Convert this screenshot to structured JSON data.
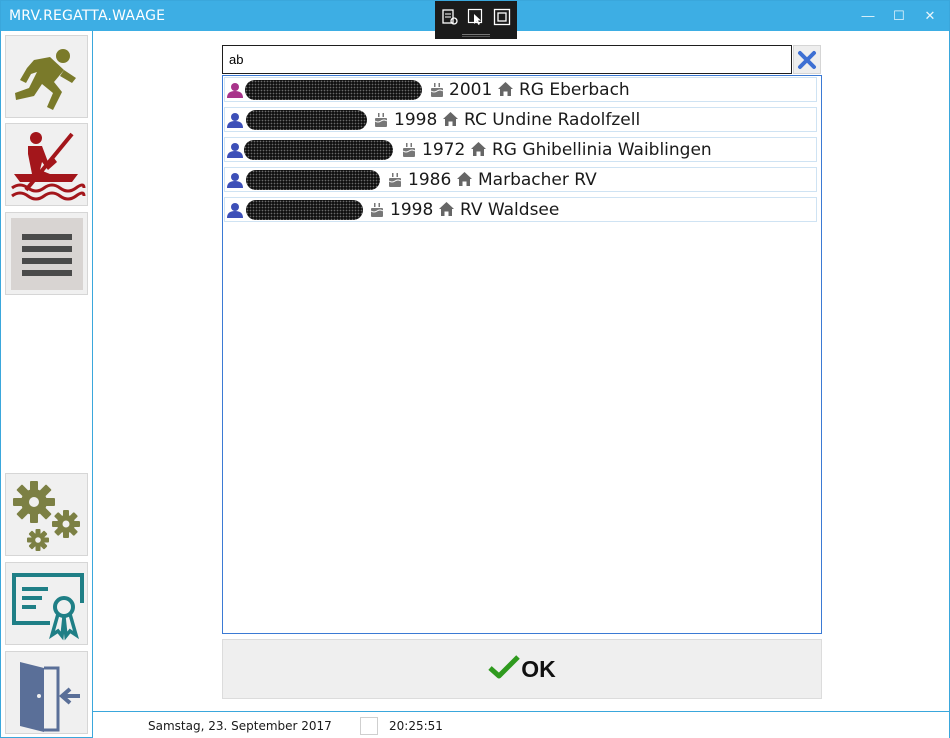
{
  "window": {
    "title": "MRV.REGATTA.WAAGE",
    "minimize_glyph": "—",
    "maximize_glyph": "☐",
    "close_glyph": "✕"
  },
  "sidebar": {
    "items": [
      {
        "name": "athlete",
        "icon": "runner-icon",
        "color": "#7a7a2a"
      },
      {
        "name": "boat",
        "icon": "rowing-boat-icon",
        "color": "#a3161b"
      },
      {
        "name": "list",
        "icon": "hamburger-menu-icon",
        "color": "#4a4a4a"
      },
      {
        "name": "settings",
        "icon": "gears-icon",
        "color": "#7c8044"
      },
      {
        "name": "certificate",
        "icon": "certificate-icon",
        "color": "#1f7f86"
      },
      {
        "name": "exit",
        "icon": "exit-door-icon",
        "color": "#5a6f98"
      }
    ]
  },
  "search": {
    "value": "ab",
    "clear_icon": "close-icon",
    "clear_color": "#3d6fd3"
  },
  "results": [
    {
      "gender": "female",
      "year": "2001",
      "club": "RG Eberbach"
    },
    {
      "gender": "male",
      "year": "1998",
      "club": "RC Undine Radolfzell"
    },
    {
      "gender": "male",
      "year": "1972",
      "club": "RG Ghibellinia Waiblingen"
    },
    {
      "gender": "male",
      "year": "1986",
      "club": "Marbacher RV"
    },
    {
      "gender": "male",
      "year": "1998",
      "club": "RV Waldsee"
    }
  ],
  "colors": {
    "female": "#a8338a",
    "male": "#3d4fb8",
    "accent": "#3daee4",
    "ok_check": "#2f9a1e"
  },
  "ok_button": {
    "label": "OK"
  },
  "status": {
    "date": "Samstag, 23. September 2017",
    "time": "20:25:51"
  }
}
